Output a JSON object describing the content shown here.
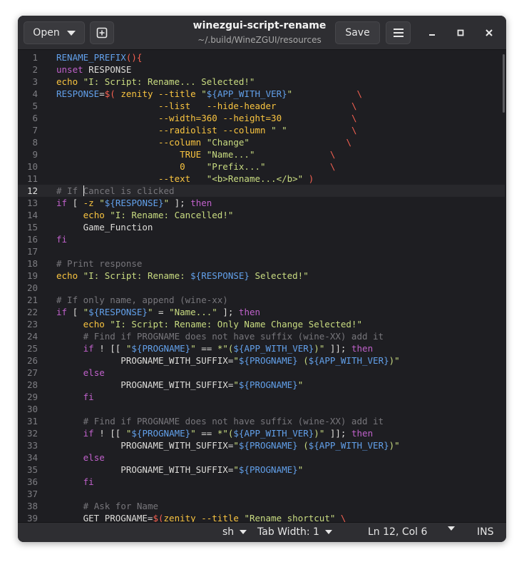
{
  "header": {
    "open_label": "Open",
    "save_label": "Save",
    "title": "winezgui-script-rename",
    "subtitle": "~/.build/WineZGUI/resources"
  },
  "status": {
    "language": "sh",
    "tab_width": "Tab Width: 1",
    "position": "Ln 12, Col 6",
    "mode": "INS"
  },
  "editor": {
    "current_line": 12,
    "lines": [
      [
        [
          "v",
          "RENAME_PREFIX"
        ],
        [
          "k",
          "(){"
        ]
      ],
      [
        [
          "kw",
          "unset"
        ],
        [
          "p",
          " RESPONSE"
        ]
      ],
      [
        [
          "o",
          "echo"
        ],
        [
          "p",
          " "
        ],
        [
          "s",
          "\"I: Script: Rename... Selected!\""
        ]
      ],
      [
        [
          "v",
          "RESPONSE"
        ],
        [
          "p",
          "="
        ],
        [
          "k",
          "$("
        ],
        [
          "p",
          " "
        ],
        [
          "o",
          "zenity"
        ],
        [
          "p",
          " "
        ],
        [
          "o",
          "--title"
        ],
        [
          "p",
          " "
        ],
        [
          "s",
          "\""
        ],
        [
          "v",
          "${APP_WITH_VER}"
        ],
        [
          "s",
          "\""
        ],
        [
          "p",
          "            "
        ],
        [
          "k",
          "\\"
        ]
      ],
      [
        [
          "p",
          "                   "
        ],
        [
          "o",
          "--list"
        ],
        [
          "p",
          "   "
        ],
        [
          "o",
          "--hide-header"
        ],
        [
          "p",
          "              "
        ],
        [
          "k",
          "\\"
        ]
      ],
      [
        [
          "p",
          "                   "
        ],
        [
          "o",
          "--width=360"
        ],
        [
          "p",
          " "
        ],
        [
          "o",
          "--height=30"
        ],
        [
          "p",
          "             "
        ],
        [
          "k",
          "\\"
        ]
      ],
      [
        [
          "p",
          "                   "
        ],
        [
          "o",
          "--radiolist"
        ],
        [
          "p",
          " "
        ],
        [
          "o",
          "--column"
        ],
        [
          "p",
          " "
        ],
        [
          "s",
          "\" \""
        ],
        [
          "p",
          "            "
        ],
        [
          "k",
          "\\"
        ]
      ],
      [
        [
          "p",
          "                   "
        ],
        [
          "o",
          "--column"
        ],
        [
          "p",
          " "
        ],
        [
          "s",
          "\"Change\""
        ],
        [
          "p",
          "                  "
        ],
        [
          "k",
          "\\"
        ]
      ],
      [
        [
          "p",
          "                       "
        ],
        [
          "o",
          "TRUE"
        ],
        [
          "p",
          " "
        ],
        [
          "s",
          "\"Name...\""
        ],
        [
          "p",
          "              "
        ],
        [
          "k",
          "\\"
        ]
      ],
      [
        [
          "p",
          "                       "
        ],
        [
          "o",
          "0"
        ],
        [
          "p",
          "    "
        ],
        [
          "s",
          "\"Prefix...\""
        ],
        [
          "p",
          "            "
        ],
        [
          "k",
          "\\"
        ]
      ],
      [
        [
          "p",
          "                   "
        ],
        [
          "o",
          "--text"
        ],
        [
          "p",
          "   "
        ],
        [
          "s",
          "\"<b>Rename...</b>\""
        ],
        [
          "p",
          " "
        ],
        [
          "k",
          ")"
        ]
      ],
      [
        [
          "c",
          "# If Cancel is clicked"
        ]
      ],
      [
        [
          "kw",
          "if"
        ],
        [
          "p",
          " [ "
        ],
        [
          "o",
          "-z"
        ],
        [
          "p",
          " "
        ],
        [
          "s",
          "\""
        ],
        [
          "v",
          "${RESPONSE}"
        ],
        [
          "s",
          "\""
        ],
        [
          "p",
          " ]; "
        ],
        [
          "kw",
          "then"
        ]
      ],
      [
        [
          "p",
          "     "
        ],
        [
          "o",
          "echo"
        ],
        [
          "p",
          " "
        ],
        [
          "s",
          "\"I: Rename: Cancelled!\""
        ]
      ],
      [
        [
          "p",
          "     Game_Function"
        ]
      ],
      [
        [
          "kw",
          "fi"
        ]
      ],
      [],
      [
        [
          "c",
          "# Print response"
        ]
      ],
      [
        [
          "o",
          "echo"
        ],
        [
          "p",
          " "
        ],
        [
          "s",
          "\"I: Script: Rename: "
        ],
        [
          "v",
          "${RESPONSE}"
        ],
        [
          "s",
          " Selected!\""
        ]
      ],
      [],
      [
        [
          "c",
          "# If only name, append (wine-xx)"
        ]
      ],
      [
        [
          "kw",
          "if"
        ],
        [
          "p",
          " [ "
        ],
        [
          "s",
          "\""
        ],
        [
          "v",
          "${RESPONSE}"
        ],
        [
          "s",
          "\""
        ],
        [
          "p",
          " = "
        ],
        [
          "s",
          "\"Name...\""
        ],
        [
          "p",
          " ]; "
        ],
        [
          "kw",
          "then"
        ]
      ],
      [
        [
          "p",
          "     "
        ],
        [
          "o",
          "echo"
        ],
        [
          "p",
          " "
        ],
        [
          "s",
          "\"I: Script: Rename: Only Name Change Selected!\""
        ]
      ],
      [
        [
          "p",
          "     "
        ],
        [
          "c",
          "# Find if PROGNAME does not have suffix (wine-XX) add it"
        ]
      ],
      [
        [
          "p",
          "     "
        ],
        [
          "kw",
          "if"
        ],
        [
          "p",
          " ! [[ "
        ],
        [
          "s",
          "\""
        ],
        [
          "v",
          "${PROGNAME}"
        ],
        [
          "s",
          "\""
        ],
        [
          "p",
          " == "
        ],
        [
          "s",
          "*\"("
        ],
        [
          "v",
          "${APP_WITH_VER}"
        ],
        [
          "s",
          ")\""
        ],
        [
          "p",
          " ]]; "
        ],
        [
          "kw",
          "then"
        ]
      ],
      [
        [
          "p",
          "            PROGNAME_WITH_SUFFIX="
        ],
        [
          "s",
          "\""
        ],
        [
          "v",
          "${PROGNAME}"
        ],
        [
          "s",
          " ("
        ],
        [
          "v",
          "${APP_WITH_VER}"
        ],
        [
          "s",
          ")\""
        ]
      ],
      [
        [
          "p",
          "     "
        ],
        [
          "kw",
          "else"
        ]
      ],
      [
        [
          "p",
          "            PROGNAME_WITH_SUFFIX="
        ],
        [
          "s",
          "\""
        ],
        [
          "v",
          "${PROGNAME}"
        ],
        [
          "s",
          "\""
        ]
      ],
      [
        [
          "p",
          "     "
        ],
        [
          "kw",
          "fi"
        ]
      ],
      [],
      [
        [
          "p",
          "     "
        ],
        [
          "c",
          "# Find if PROGNAME does not have suffix (wine-XX) add it"
        ]
      ],
      [
        [
          "p",
          "     "
        ],
        [
          "kw",
          "if"
        ],
        [
          "p",
          " ! [[ "
        ],
        [
          "s",
          "\""
        ],
        [
          "v",
          "${PROGNAME}"
        ],
        [
          "s",
          "\""
        ],
        [
          "p",
          " == "
        ],
        [
          "s",
          "*\"("
        ],
        [
          "v",
          "${APP_WITH_VER}"
        ],
        [
          "s",
          ")\""
        ],
        [
          "p",
          " ]]; "
        ],
        [
          "kw",
          "then"
        ]
      ],
      [
        [
          "p",
          "            PROGNAME_WITH_SUFFIX="
        ],
        [
          "s",
          "\""
        ],
        [
          "v",
          "${PROGNAME}"
        ],
        [
          "s",
          " ("
        ],
        [
          "v",
          "${APP_WITH_VER}"
        ],
        [
          "s",
          ")\""
        ]
      ],
      [
        [
          "p",
          "     "
        ],
        [
          "kw",
          "else"
        ]
      ],
      [
        [
          "p",
          "            PROGNAME_WITH_SUFFIX="
        ],
        [
          "s",
          "\""
        ],
        [
          "v",
          "${PROGNAME}"
        ],
        [
          "s",
          "\""
        ]
      ],
      [
        [
          "p",
          "     "
        ],
        [
          "kw",
          "fi"
        ]
      ],
      [],
      [
        [
          "p",
          "     "
        ],
        [
          "c",
          "# Ask for Name"
        ]
      ],
      [
        [
          "p",
          "     GET_PROGNAME="
        ],
        [
          "k",
          "$("
        ],
        [
          "o",
          "zenity"
        ],
        [
          "p",
          " "
        ],
        [
          "o",
          "--title"
        ],
        [
          "p",
          " "
        ],
        [
          "s",
          "\"Rename shortcut\""
        ],
        [
          "p",
          " "
        ],
        [
          "k",
          "\\"
        ]
      ]
    ]
  }
}
